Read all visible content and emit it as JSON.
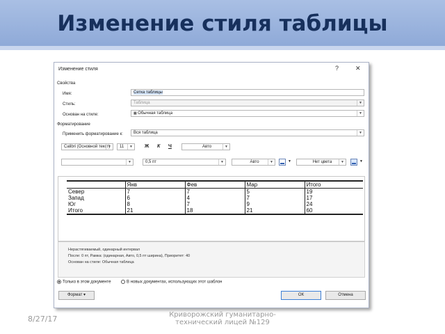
{
  "slide": {
    "title": "Изменение стиля таблицы",
    "date": "8/27/17",
    "footer_line1": "Криворожский гуманитарно-",
    "footer_line2": "технический лицей №129"
  },
  "dialog": {
    "title": "Изменение стиля",
    "help_label": "?",
    "close_label": "✕",
    "properties": {
      "section": "Свойства",
      "name_label": "Имя:",
      "name_value": "Сетка таблицы",
      "type_label": "Стиль:",
      "type_value": "Таблица",
      "based_label": "Основан на стиле:",
      "based_value": "Обычная таблица"
    },
    "formatting": {
      "section": "Форматирование",
      "apply_label": "Применить форматирование к:",
      "apply_value": "Вся таблица",
      "font_value": "Calibri (Основной текст)",
      "size_value": "11",
      "bold_label": "Ж",
      "italic_label": "К",
      "underline_label": "Ч",
      "color_value": "Авто",
      "line_style_value": "",
      "line_width_value": "0,5 пт",
      "border_color_value": "Авто",
      "shading_value": "Нет цвета"
    },
    "preview": {
      "header": [
        "",
        "Янв",
        "Фев",
        "Мар",
        "Итого"
      ],
      "rows": [
        [
          "Север",
          "7",
          "7",
          "5",
          "19"
        ],
        [
          "Запад",
          "6",
          "4",
          "7",
          "17"
        ],
        [
          "Юг",
          "8",
          "7",
          "9",
          "24"
        ],
        [
          "Итого",
          "21",
          "18",
          "21",
          "60"
        ]
      ]
    },
    "description": {
      "line1": "Нерастягиваемый, одинарный интервал",
      "line2": "После: 0 пт, Рамка: (одинарная, Авто, 0,5 пт ширина), Приоритет: 40",
      "line3": "Основан на стиле: Обычная таблица"
    },
    "radio_only_doc": "Только в этом документе",
    "radio_new_docs": "В новых документах, использующих этот шаблон",
    "format_button": "Формат ▾",
    "ok_button": "ОК",
    "cancel_button": "Отмена"
  }
}
